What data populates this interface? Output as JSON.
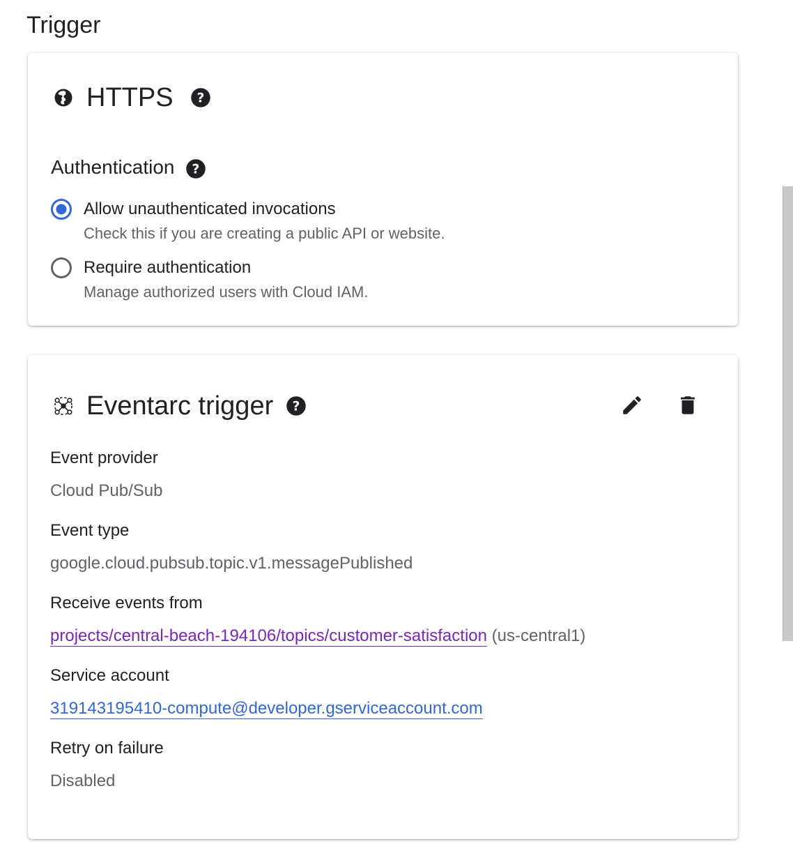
{
  "section": {
    "title": "Trigger"
  },
  "https_card": {
    "title": "HTTPS",
    "icon": "globe-icon",
    "auth_heading": "Authentication",
    "options": [
      {
        "label": "Allow unauthenticated invocations",
        "description": "Check this if you are creating a public API or website.",
        "selected": true
      },
      {
        "label": "Require authentication",
        "description": "Manage authorized users with Cloud IAM.",
        "selected": false
      }
    ]
  },
  "eventarc_card": {
    "title": "Eventarc trigger",
    "icon": "eventarc-icon",
    "actions": [
      "edit-icon",
      "delete-icon"
    ],
    "fields": {
      "event_provider": {
        "label": "Event provider",
        "value": "Cloud Pub/Sub"
      },
      "event_type": {
        "label": "Event type",
        "value": "google.cloud.pubsub.topic.v1.messagePublished"
      },
      "receive_from": {
        "label": "Receive events from",
        "link": "projects/central-beach-194106/topics/customer-satisfaction",
        "region": "(us-central1)"
      },
      "service_account": {
        "label": "Service account",
        "link": "319143195410-compute@developer.gserviceaccount.com"
      },
      "retry": {
        "label": "Retry on failure",
        "value": "Disabled"
      }
    }
  },
  "colors": {
    "radio_selected": "#3367d6",
    "radio_unselected": "#5f6368",
    "visited_link": "#7627bb",
    "link": "#3367d6",
    "scrollbar": "#c9c9c9"
  }
}
